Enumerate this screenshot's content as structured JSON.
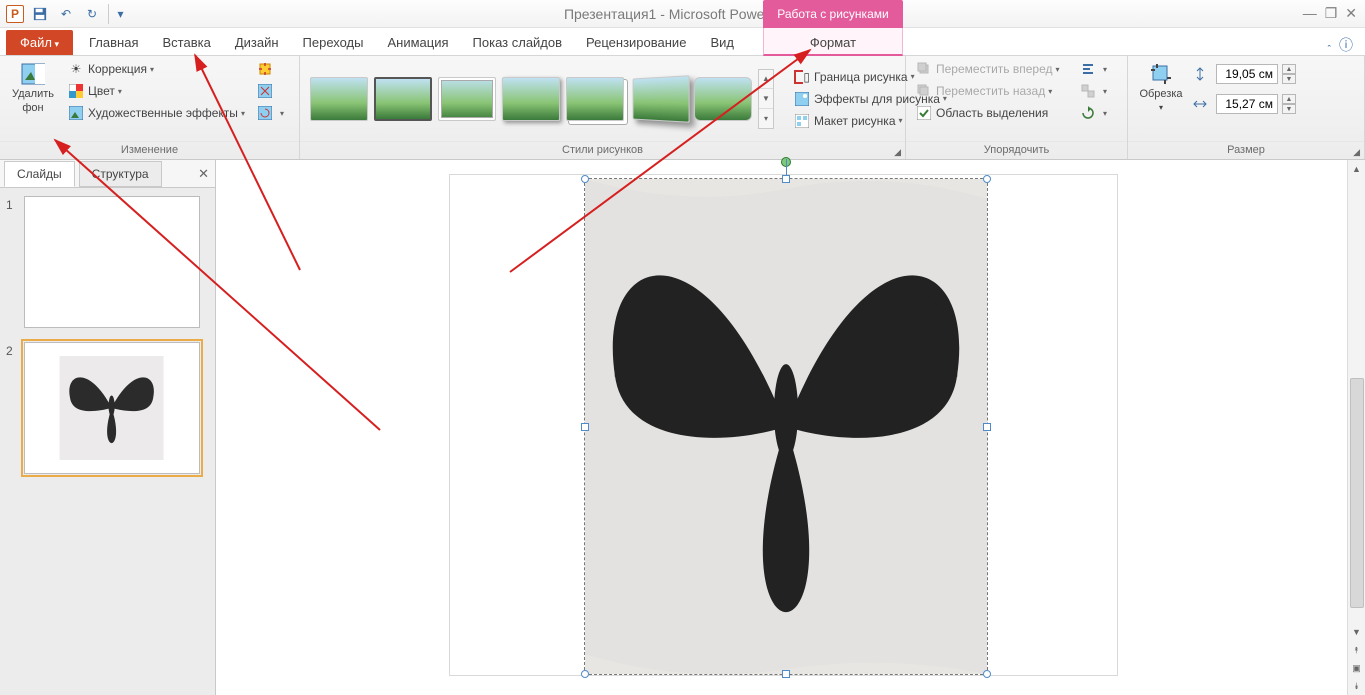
{
  "title": {
    "doc": "Презентация1",
    "app": "Microsoft PowerPoint"
  },
  "contextual_tab": "Работа с рисунками",
  "file_tab": "Файл",
  "tabs": [
    "Главная",
    "Вставка",
    "Дизайн",
    "Переходы",
    "Анимация",
    "Показ слайдов",
    "Рецензирование",
    "Вид"
  ],
  "format_tab": "Формат",
  "ribbon": {
    "remove_bg_l1": "Удалить",
    "remove_bg_l2": "фон",
    "corrections": "Коррекция",
    "color": "Цвет",
    "artistic": "Художественные эффекты",
    "group_change": "Изменение",
    "group_styles": "Стили рисунков",
    "border": "Граница рисунка",
    "effects": "Эффекты для рисунка",
    "layout": "Макет рисунка",
    "bring_forward": "Переместить вперед",
    "send_backward": "Переместить назад",
    "selection_pane": "Область выделения",
    "group_arrange": "Упорядочить",
    "crop": "Обрезка",
    "group_size": "Размер",
    "height": "19,05 см",
    "width": "15,27 см"
  },
  "side": {
    "slides": "Слайды",
    "outline": "Структура",
    "n1": "1",
    "n2": "2"
  }
}
